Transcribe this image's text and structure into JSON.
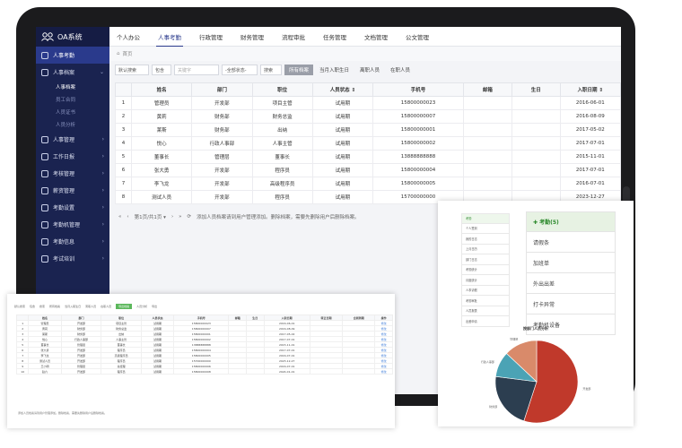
{
  "app": {
    "title": "OA系统"
  },
  "sidebar": {
    "groups": [
      {
        "label": "人事考勤",
        "active": true
      },
      {
        "label": "人事档案"
      },
      {
        "label": "人事管理"
      },
      {
        "label": "工作日报"
      },
      {
        "label": "考核管理"
      },
      {
        "label": "薪资管理"
      },
      {
        "label": "考勤设置"
      },
      {
        "label": "考勤机管理"
      },
      {
        "label": "考勤信息"
      },
      {
        "label": "考试培训"
      }
    ],
    "subitems": [
      "人事档案",
      "员工合同",
      "人员证书",
      "人员分析"
    ]
  },
  "topnav": {
    "tabs": [
      "个人办公",
      "人事考勤",
      "行政管理",
      "财务管理",
      "流程审批",
      "任务管理",
      "文档管理",
      "公文管理"
    ]
  },
  "breadcrumb": "首页",
  "toolbar": {
    "filter1": "默认搜索",
    "filter2": "包含",
    "keyword_placeholder": "关键字",
    "status_select": "-全部状态-",
    "search_btn": "搜索",
    "tabs": [
      "所有档案",
      "当月入职生日",
      "离职人员",
      "在职人员"
    ]
  },
  "table": {
    "headers": [
      "",
      "姓名",
      "部门",
      "职位",
      "人员状态 ⇕",
      "手机号",
      "邮箱",
      "生日",
      "入职日期 ⇕"
    ],
    "rows": [
      [
        "1",
        "管理员",
        "开发部",
        "项目主管",
        "试用期",
        "15800000023",
        "",
        "",
        "2016-06-01"
      ],
      [
        "2",
        "黄莉",
        "财务部",
        "财务总监",
        "试用期",
        "15800000007",
        "",
        "",
        "2016-08-09"
      ],
      [
        "3",
        "莱斯",
        "财务部",
        "出纳",
        "试用期",
        "15800000001",
        "",
        "",
        "2017-05-02"
      ],
      [
        "4",
        "悦心",
        "行政人事部",
        "人事主管",
        "试用期",
        "15800000002",
        "",
        "",
        "2017-07-01"
      ],
      [
        "5",
        "董事长",
        "管理层",
        "董事长",
        "试用期",
        "13888888888",
        "",
        "",
        "2015-11-01"
      ],
      [
        "6",
        "张大勇",
        "开发部",
        "程序员",
        "试用期",
        "15800000004",
        "",
        "",
        "2017-07-01"
      ],
      [
        "7",
        "李飞龙",
        "开发部",
        "高级程序员",
        "试用期",
        "15800000005",
        "",
        "",
        "2016-07-01"
      ],
      [
        "8",
        "测试人员",
        "开发部",
        "程序员",
        "试用期",
        "15700000000",
        "",
        "",
        "2023-12-27"
      ]
    ]
  },
  "pager": {
    "first": "«",
    "prev": "‹",
    "pageinfo": "第1页/共1页 ▾",
    "next": "›",
    "last": "»",
    "refresh": "⟳",
    "hint": "添加人员档案请到用户管理添加。删除档案，需要先删除用户后删除档案。"
  },
  "card_a": {
    "toolbar": [
      "默认搜索",
      "包含",
      "搜索",
      "所有档案",
      "当月入职生日",
      "离职人员",
      "在职人员",
      "导出档案",
      "人员分析",
      "导出"
    ],
    "headers": [
      "",
      "姓名",
      "部门",
      "职位",
      "人员状态",
      "手机号",
      "邮箱",
      "生日",
      "入职日期",
      "转正日期",
      "合同到期",
      "操作"
    ],
    "rows": [
      [
        "1",
        "管理员",
        "开发部",
        "项目主管",
        "试用期",
        "15800000023",
        "",
        "",
        "2016-06-01",
        "",
        "",
        "修改"
      ],
      [
        "2",
        "黄莉",
        "财务部",
        "财务总监",
        "试用期",
        "15800000007",
        "",
        "",
        "2016-08-09",
        "",
        "",
        "修改"
      ],
      [
        "3",
        "莱斯",
        "财务部",
        "出纳",
        "试用期",
        "15800000001",
        "",
        "",
        "2017-05-02",
        "",
        "",
        "修改"
      ],
      [
        "4",
        "悦心",
        "行政人事部",
        "人事主管",
        "试用期",
        "15800000002",
        "",
        "",
        "2017-07-01",
        "",
        "",
        "修改"
      ],
      [
        "5",
        "董事长",
        "管理层",
        "董事长",
        "试用期",
        "13888888888",
        "",
        "",
        "2015-11-01",
        "",
        "",
        "修改"
      ],
      [
        "6",
        "张大勇",
        "开发部",
        "程序员",
        "试用期",
        "15800000004",
        "",
        "",
        "2017-07-01",
        "",
        "",
        "修改"
      ],
      [
        "7",
        "李飞龙",
        "开发部",
        "高级程序员",
        "试用期",
        "15800000005",
        "",
        "",
        "2016-07-01",
        "",
        "",
        "修改"
      ],
      [
        "8",
        "测试人员",
        "开发部",
        "程序员",
        "试用期",
        "15700000000",
        "",
        "",
        "2023-12-27",
        "",
        "",
        "修改"
      ],
      [
        "9",
        "王小明",
        "管理层",
        "总经理",
        "试用期",
        "15800000006",
        "",
        "",
        "2016-07-01",
        "",
        "",
        "修改"
      ],
      [
        "10",
        "赵六",
        "开发部",
        "程序员",
        "试用期",
        "15800000008",
        "",
        "",
        "2024-01-01",
        "",
        "",
        "修改"
      ]
    ],
    "footer": "添加人员档案请到用户管理添加。删除档案，需要先删除用户后删除档案。"
  },
  "card_b": {
    "left_menu": [
      "考勤",
      "个人签到",
      "我的日志",
      "上月日历",
      "部门日志",
      "考勤统计",
      "月度统计",
      "人事请假",
      "考勤审批",
      "人员报表",
      "出差申请"
    ],
    "right_menu": [
      "✚ 考勤(5)",
      "请假条",
      "加班单",
      "外出出差",
      "打卡异常",
      "考勤机设备"
    ],
    "pie_title": "按部门人员分析",
    "pie_labels": [
      "开发部",
      "财务部",
      "行政人事部",
      "管理层"
    ]
  },
  "colors": {
    "sidebar": "#1a2350",
    "accent": "#2a3a8c",
    "green": "#5cb85c",
    "pie": [
      "#c0392b",
      "#2c3e50",
      "#4ba3b5",
      "#d98a6a"
    ]
  },
  "chart_data": {
    "type": "pie",
    "title": "按部门人员分析",
    "categories": [
      "开发部",
      "财务部",
      "行政人事部",
      "管理层"
    ],
    "values": [
      55,
      22,
      10,
      13
    ]
  }
}
